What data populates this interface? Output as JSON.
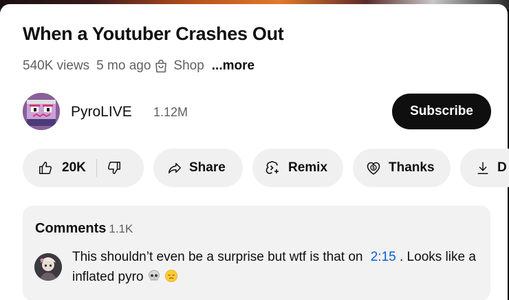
{
  "video": {
    "title": "When a Youtuber Crashes Out",
    "views": "540K views",
    "age": "5 mo ago",
    "shop_label": "Shop",
    "more_label": "...more"
  },
  "channel": {
    "name": "PyroLIVE",
    "subscribers": "1.12M",
    "subscribe_label": "Subscribe"
  },
  "actions": {
    "like_count": "20K",
    "share_label": "Share",
    "remix_label": "Remix",
    "thanks_label": "Thanks",
    "download_label": "D"
  },
  "comments": {
    "heading": "Comments",
    "count": "1.1K",
    "top_comment": {
      "text_before": "This shouldn’t even be a surprise but wtf is that on",
      "timestamp": "2:15",
      "text_after": ". Looks like a inflated pyro",
      "emojis": [
        "skull-emoji",
        "disappointed-face-emoji"
      ]
    }
  },
  "colors": {
    "accent_link": "#065fd4",
    "subscribe_bg": "#0f0f0f",
    "pill_bg": "#f0f0f0",
    "secondary_text": "#606060"
  }
}
